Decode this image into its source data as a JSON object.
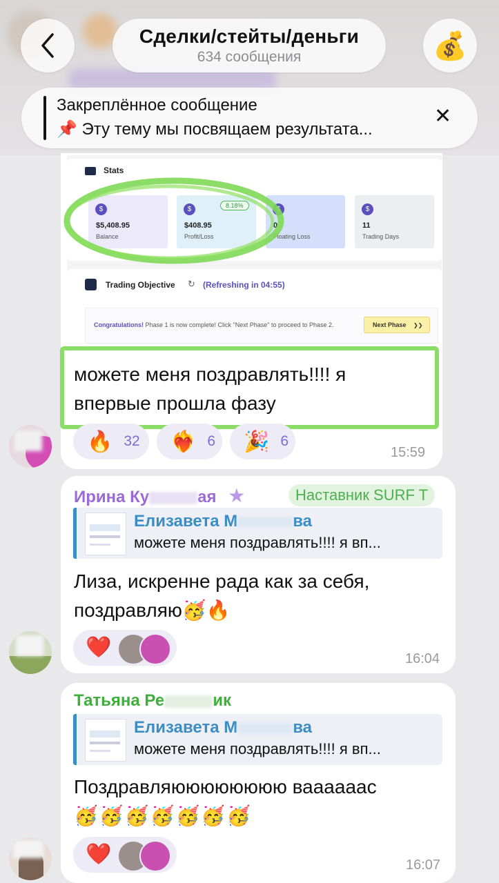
{
  "header": {
    "title": "Сделки/стейты/деньги",
    "subtitle": "634 сообщения",
    "back_icon": "chevron-left-icon",
    "avatar_icon": "money-bag-icon",
    "avatar_emoji": "💰"
  },
  "pinned": {
    "title": "Закреплённое сообщение",
    "text": "📌 Эту тему мы посвящаем результата...",
    "close_glyph": "✕"
  },
  "screenshot": {
    "stats_title": "Stats",
    "cards": [
      {
        "value": "$5,408.95",
        "label": "Balance",
        "color": "#ece9fb"
      },
      {
        "value": "$408.95",
        "label": "Profit/Loss",
        "badge": "8.18%",
        "color": "#dff0f8"
      },
      {
        "value": "0",
        "label": "Floating Loss",
        "color": "#d4e0fb"
      },
      {
        "value": "11",
        "label": "Trading Days",
        "color": "#eceef1"
      }
    ],
    "objective_title": "Trading Objective",
    "refresh_text": "(Refreshing in 04:55)",
    "congrats_strong": "Congratulations!",
    "congrats_text": " Phase 1 is now complete! Click \"Next Phase\" to proceed to Phase 2.",
    "next_button": "Next Phase",
    "next_glyph": "❯❯"
  },
  "messages": [
    {
      "text_line1": "можете меня поздравлять!!!! я",
      "text_line2": "впервые прошла фазу",
      "reactions": [
        {
          "emoji": "🔥",
          "count": "32"
        },
        {
          "emoji": "❤️‍🔥",
          "count": "6"
        },
        {
          "emoji": "🎉",
          "count": "6"
        }
      ],
      "time": "15:59"
    },
    {
      "author": "Ирина Ку",
      "author_tail": "ая",
      "author_color": "#9b6ad6",
      "star": "★",
      "role": "Наставник SURF T",
      "quote_author": "Елизавета М",
      "quote_author_tail": "ва",
      "quote_text": "можете меня поздравлять!!!! я вп...",
      "text_line1": "Лиза, искренне рада как за себя,",
      "text_line2": "поздравляю🥳🔥",
      "reaction_emoji": "❤️",
      "time": "16:04"
    },
    {
      "author": "Татьяна Ре",
      "author_tail": "ик",
      "author_color": "#3fae3a",
      "quote_author": "Елизавета М",
      "quote_author_tail": "ва",
      "quote_text": "можете меня поздравлять!!!! я вп...",
      "text_line1": "Поздравляюююююююю ваааааас",
      "text_line2": "🥳🥳🥳🥳🥳🥳🥳",
      "reaction_emoji": "❤️",
      "time": "16:07"
    }
  ]
}
